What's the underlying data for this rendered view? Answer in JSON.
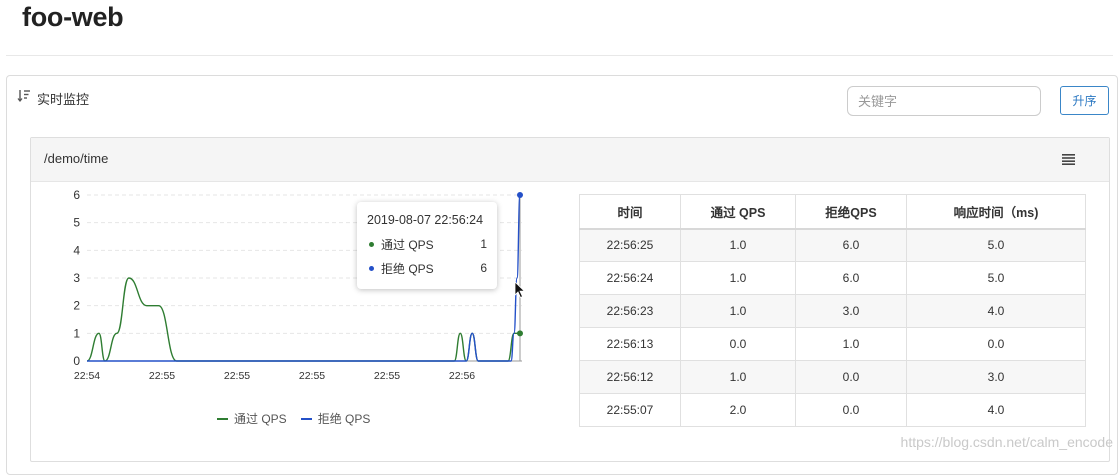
{
  "app": {
    "title": "foo-web"
  },
  "panel": {
    "title": "实时监控",
    "search_placeholder": "关键字",
    "sort_button_label": "升序"
  },
  "card": {
    "resource": "/demo/time"
  },
  "legend": {
    "pass": "通过 QPS",
    "block": "拒绝 QPS"
  },
  "tooltip": {
    "time": "2019-08-07 22:56:24",
    "rows": [
      {
        "name": "通过 QPS",
        "value": "1"
      },
      {
        "name": "拒绝 QPS",
        "value": "6"
      }
    ]
  },
  "table": {
    "headers": [
      "时间",
      "通过 QPS",
      "拒绝QPS",
      "响应时间（ms)"
    ],
    "rows": [
      [
        "22:56:25",
        "1.0",
        "6.0",
        "5.0"
      ],
      [
        "22:56:24",
        "1.0",
        "6.0",
        "5.0"
      ],
      [
        "22:56:23",
        "1.0",
        "3.0",
        "4.0"
      ],
      [
        "22:56:13",
        "0.0",
        "1.0",
        "0.0"
      ],
      [
        "22:56:12",
        "1.0",
        "0.0",
        "3.0"
      ],
      [
        "22:55:07",
        "2.0",
        "0.0",
        "4.0"
      ]
    ]
  },
  "watermark": "https://blog.csdn.net/calm_encode",
  "colors": {
    "pass": "#2f7d32",
    "block": "#2450c8",
    "accent": "#2b78c2"
  },
  "chart_data": {
    "type": "line",
    "ylim": [
      0,
      6
    ],
    "yticks": [
      "0",
      "1",
      "2",
      "3",
      "4",
      "5",
      "6"
    ],
    "xticks": [
      "22:54",
      "22:55",
      "22:55",
      "22:55",
      "22:55",
      "22:56"
    ],
    "series": [
      {
        "name": "通过 QPS",
        "x": [
          "22:54:00",
          "22:54:04",
          "22:54:06",
          "22:54:10",
          "22:54:14",
          "22:54:20",
          "22:54:24",
          "22:54:30",
          "22:54:34",
          "22:54:42",
          "22:56:03",
          "22:56:05",
          "22:56:07",
          "22:56:09",
          "22:56:11",
          "22:56:21",
          "22:56:23",
          "22:56:24",
          "22:56:25"
        ],
        "values": [
          0,
          1,
          0,
          1,
          3,
          2,
          2,
          0,
          0,
          0,
          0,
          1,
          0,
          1,
          0,
          0,
          1,
          1,
          1
        ]
      },
      {
        "name": "拒绝 QPS",
        "x": [
          "22:54:00",
          "22:56:02",
          "22:56:05",
          "22:56:07",
          "22:56:09",
          "22:56:11",
          "22:56:20",
          "22:56:22",
          "22:56:23",
          "22:56:24",
          "22:56:25"
        ],
        "values": [
          0,
          0,
          0,
          0,
          1,
          0,
          0,
          0,
          1,
          3,
          6
        ]
      }
    ]
  }
}
